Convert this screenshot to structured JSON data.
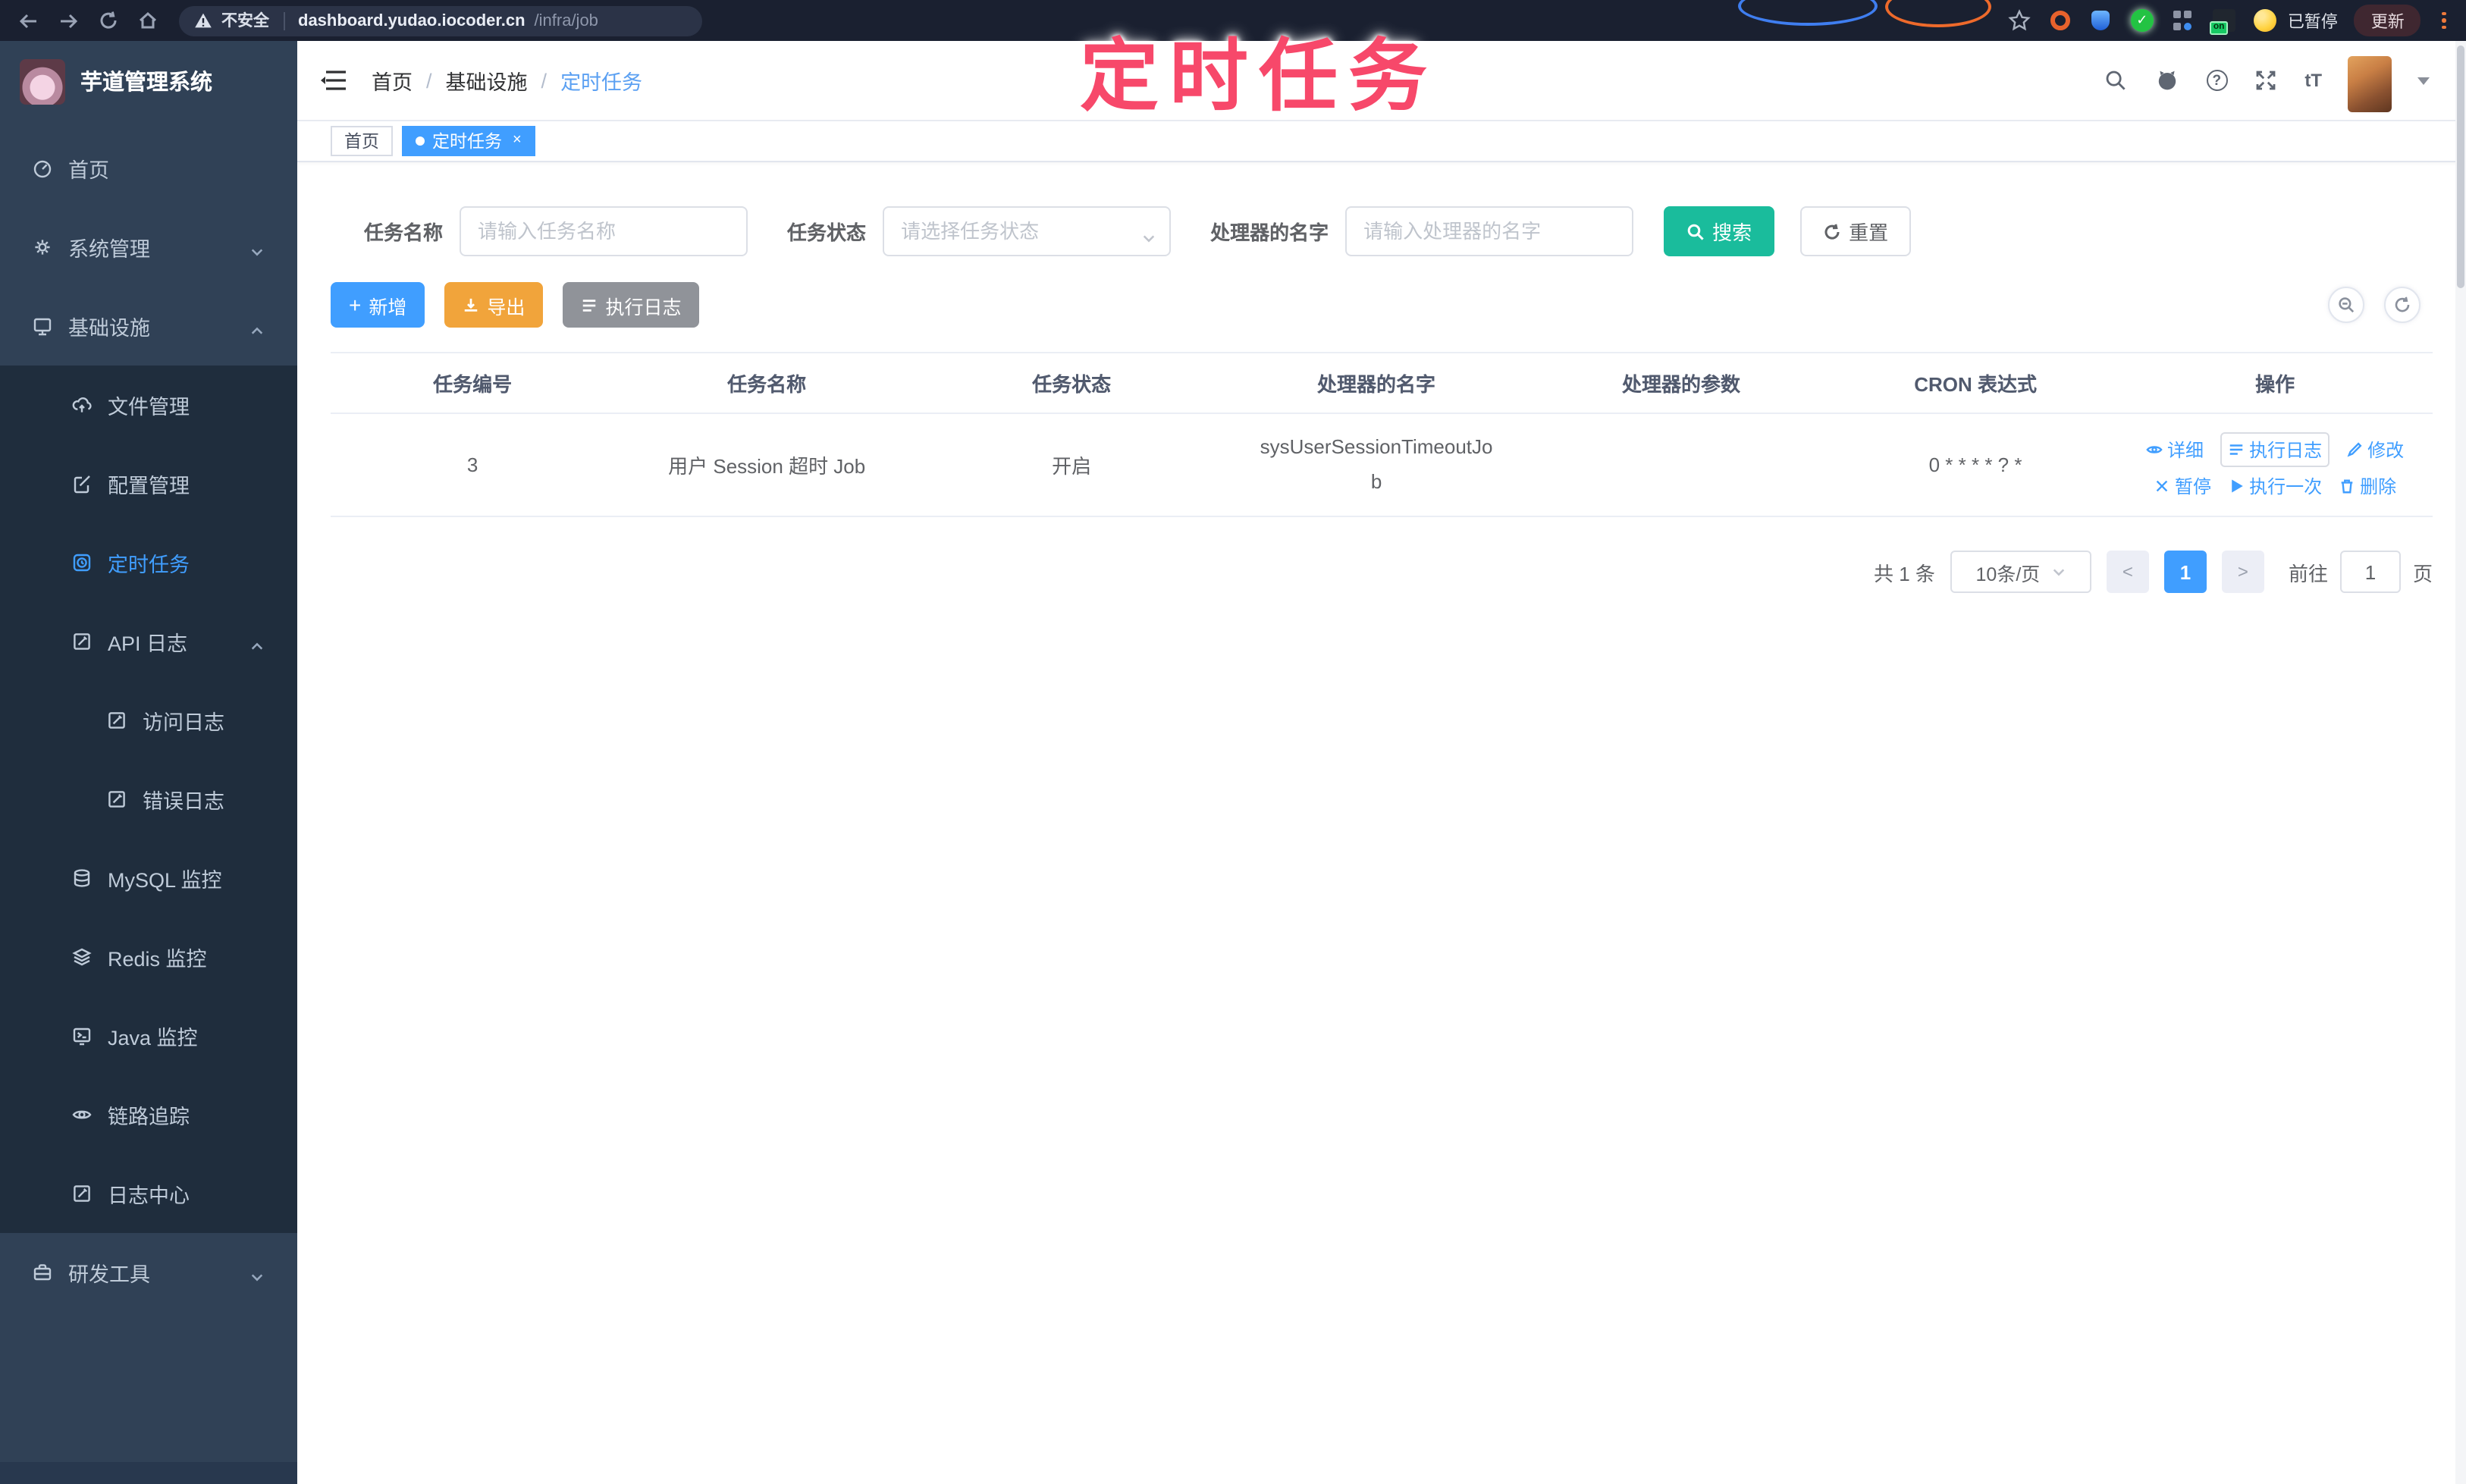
{
  "browser": {
    "security_label": "不安全",
    "url_domain": "dashboard.yudao.iocoder.cn",
    "url_path": "/infra/job",
    "extension_on_badge": "on",
    "paused_label": "已暂停",
    "update_label": "更新"
  },
  "annotation": {
    "title": "定时任务",
    "color": "#f7486a"
  },
  "sidebar": {
    "app_title": "芋道管理系统",
    "items": [
      {
        "label": "首页",
        "icon": "gauge-icon",
        "level": "root"
      },
      {
        "label": "系统管理",
        "icon": "gear-icon",
        "level": "root",
        "chevron": "down"
      },
      {
        "label": "基础设施",
        "icon": "monitor-icon",
        "level": "root",
        "chevron": "up"
      },
      {
        "label": "文件管理",
        "icon": "cloud-upload-icon",
        "level": "sub"
      },
      {
        "label": "配置管理",
        "icon": "edit-icon",
        "level": "sub"
      },
      {
        "label": "定时任务",
        "icon": "timer-icon",
        "level": "sub",
        "active": true
      },
      {
        "label": "API 日志",
        "icon": "log-icon",
        "level": "sub",
        "chevron": "up"
      },
      {
        "label": "访问日志",
        "icon": "log-icon",
        "level": "subsub"
      },
      {
        "label": "错误日志",
        "icon": "log-icon",
        "level": "subsub"
      },
      {
        "label": "MySQL 监控",
        "icon": "database-icon",
        "level": "sub"
      },
      {
        "label": "Redis 监控",
        "icon": "layers-icon",
        "level": "sub"
      },
      {
        "label": "Java 监控",
        "icon": "java-icon",
        "level": "sub"
      },
      {
        "label": "链路追踪",
        "icon": "eye-icon",
        "level": "sub"
      },
      {
        "label": "日志中心",
        "icon": "log-icon",
        "level": "sub"
      },
      {
        "label": "研发工具",
        "icon": "toolbox-icon",
        "level": "root",
        "chevron": "down"
      }
    ]
  },
  "navbar": {
    "breadcrumb": [
      "首页",
      "基础设施",
      "定时任务"
    ],
    "separator": "/",
    "icons": [
      "search-icon",
      "github-icon",
      "help-icon",
      "fullscreen-icon",
      "text-size-icon",
      "avatar",
      "caret-down-icon"
    ],
    "text_size_glyph": "tT"
  },
  "tabs": [
    {
      "label": "首页",
      "active": false
    },
    {
      "label": "定时任务",
      "active": true,
      "close_glyph": "×"
    }
  ],
  "filters": {
    "name_label": "任务名称",
    "name_placeholder": "请输入任务名称",
    "status_label": "任务状态",
    "status_placeholder": "请选择任务状态",
    "handler_label": "处理器的名字",
    "handler_placeholder": "请输入处理器的名字",
    "search_label": "搜索",
    "reset_label": "重置"
  },
  "toolbar": {
    "add_label": "新增",
    "export_label": "导出",
    "exec_log_label": "执行日志",
    "plus_glyph": "+"
  },
  "table": {
    "headers": [
      "任务编号",
      "任务名称",
      "任务状态",
      "处理器的名字",
      "处理器的参数",
      "CRON 表达式",
      "操作"
    ],
    "row": {
      "id": "3",
      "name": "用户 Session 超时 Job",
      "status": "开启",
      "handler": "sysUserSessionTimeoutJob",
      "param": "",
      "cron": "0 * * * * ? *"
    },
    "actions": [
      {
        "icon": "eye-icon",
        "label": "详细"
      },
      {
        "icon": "list-icon",
        "label": "执行日志"
      },
      {
        "icon": "pen-icon",
        "label": "修改"
      },
      {
        "icon": "close-icon",
        "label": "暂停"
      },
      {
        "icon": "play-icon",
        "label": "执行一次"
      },
      {
        "icon": "trash-icon",
        "label": "删除"
      }
    ]
  },
  "pagination": {
    "total_label": "共 1 条",
    "page_size": "10条/页",
    "prev_glyph": "<",
    "next_glyph": ">",
    "current_page": "1",
    "goto_label": "前往",
    "goto_value": "1",
    "page_unit": "页"
  },
  "colors": {
    "accent_blue": "#409eff",
    "search_teal": "#1abc9c",
    "export_amber": "#f1a43b",
    "sidebar_bg": "#304156",
    "submenu_bg": "#1f2d3d",
    "annotation_pink": "#f7486a"
  }
}
